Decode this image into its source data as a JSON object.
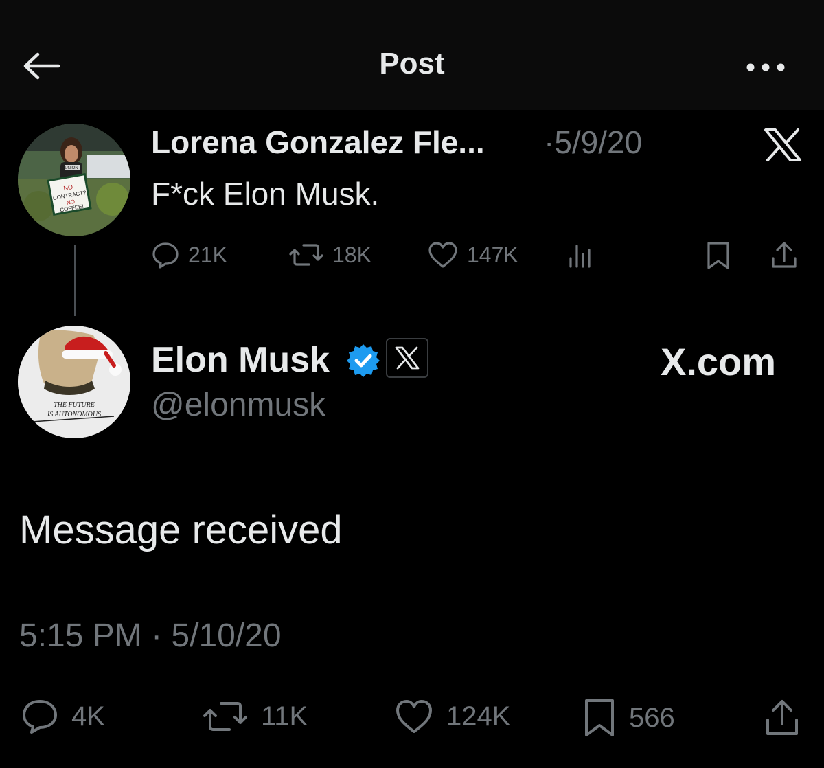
{
  "header": {
    "title": "Post"
  },
  "original_post": {
    "author_name": "Lorena Gonzalez Fle...",
    "date": "·5/9/20",
    "text": "F*ck Elon Musk.",
    "replies": "21K",
    "reposts": "18K",
    "likes": "147K",
    "avatar_sign_text": "NO CONTRACT? NO COFFEE!",
    "avatar_shirt_text": "UNION"
  },
  "reply_post": {
    "author_name": "Elon Musk",
    "handle": "@elonmusk",
    "affiliation_label": "X.com",
    "text": "Message received",
    "timestamp": "5:15 PM · 5/10/20",
    "replies": "4K",
    "reposts": "11K",
    "likes": "124K",
    "bookmarks": "566",
    "avatar_text": "THE FUTURE IS AUTONOMOUS"
  },
  "colors": {
    "background": "#000000",
    "header_background": "#0b0b0b",
    "primary_text": "#e7e9ea",
    "secondary_text": "#71767b",
    "verified_blue": "#1d9bf0"
  },
  "icons": {
    "back": "arrow-left-icon",
    "more": "more-dots-icon",
    "x_logo": "x-logo-icon",
    "reply": "reply-icon",
    "repost": "repost-icon",
    "like": "heart-icon",
    "views": "views-icon",
    "bookmark": "bookmark-icon",
    "share": "share-icon",
    "verified": "verified-badge-icon"
  }
}
